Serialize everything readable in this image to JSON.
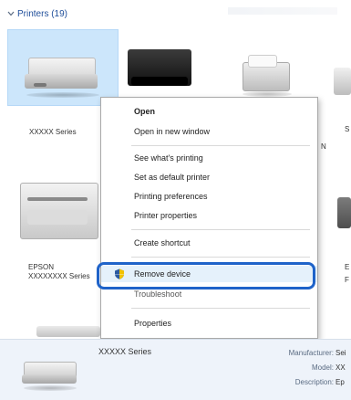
{
  "header": {
    "title": "Printers (19)"
  },
  "devices": [
    {
      "label": "XXXXX Series"
    },
    {
      "label": "EPSON XXXXXXXX Series"
    }
  ],
  "right_partial": {
    "label_a": "S",
    "label_b": "N",
    "label_c": "E",
    "label_d": "F"
  },
  "context_menu": {
    "items": [
      {
        "label": "Open"
      },
      {
        "label": "Open in new window"
      },
      {
        "label": "See what's printing"
      },
      {
        "label": "Set as default printer"
      },
      {
        "label": "Printing preferences"
      },
      {
        "label": "Printer properties"
      },
      {
        "label": "Create shortcut"
      },
      {
        "label": "Remove device"
      },
      {
        "label": "Troubleshoot"
      },
      {
        "label": "Properties"
      }
    ]
  },
  "details": {
    "name": "XXXXX Series",
    "manufacturer_key": "Manufacturer:",
    "manufacturer_val": "Sei",
    "model_key": "Model:",
    "model_val": "XX",
    "description_key": "Description:",
    "description_val": "Ep"
  },
  "colors": {
    "accent": "#1f63c9",
    "selected_tile": "#cce6fb",
    "details_bg": "#eef3fa"
  }
}
